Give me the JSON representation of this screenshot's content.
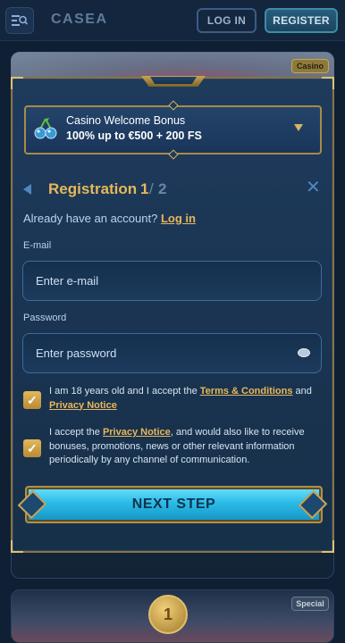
{
  "header": {
    "logo": "CASEA",
    "login_label": "LOG IN",
    "register_label": "REGISTER",
    "menu_icon": "menu-search-icon"
  },
  "background": {
    "casino_tag": "Casino",
    "special_tag": "Special",
    "coin_label": "1"
  },
  "bonus": {
    "line1": "Casino Welcome Bonus",
    "line2": "100% up to €500 + 200 FS",
    "icon": "cherries-icon"
  },
  "registration": {
    "title": "Registration",
    "step": "1",
    "separator": "/",
    "total": "2",
    "have_account": "Already have an account?",
    "login_link": "Log in"
  },
  "form": {
    "email_label": "E-mail",
    "email_placeholder": "Enter e-mail",
    "password_label": "Password",
    "password_placeholder": "Enter password"
  },
  "consent": {
    "age_prefix": "I am 18 years old and I accept the ",
    "terms_link": "Terms & Conditions",
    "age_and": " and ",
    "privacy_link": "Privacy Notice",
    "marketing_prefix": "I accept the ",
    "marketing_privacy_link": "Privacy Notice",
    "marketing_suffix": ", and would also like to receive bonuses, promotions, news or other relevant information periodically by any channel of communication."
  },
  "next_step_label": "NEXT STEP",
  "colors": {
    "accent_gold": "#e7b85a",
    "cta_blue": "#2bbbe6",
    "background": "#0f2034"
  }
}
